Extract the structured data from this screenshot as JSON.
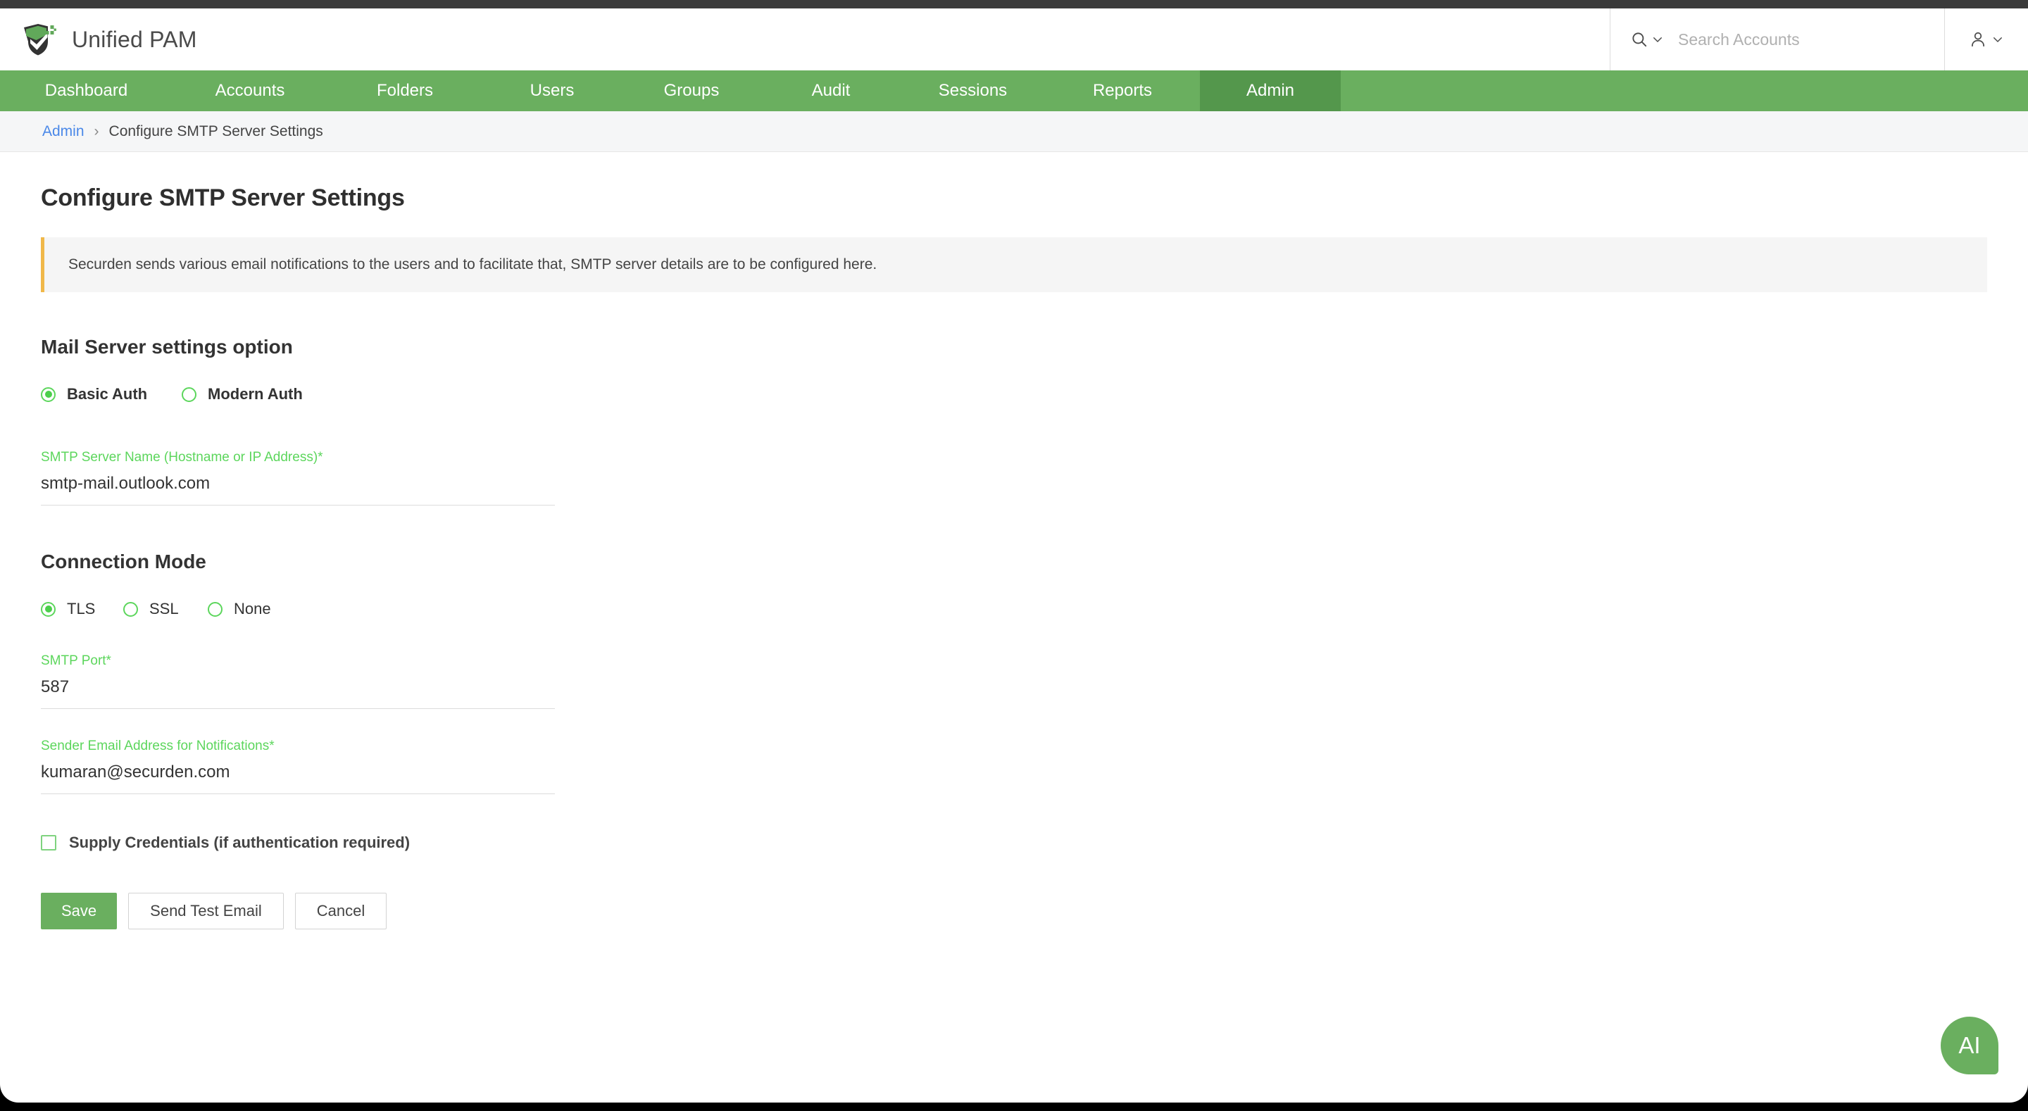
{
  "app": {
    "title": "Unified PAM",
    "logo_icon": "shield-check-logo"
  },
  "search": {
    "icon": "search-icon",
    "chevron_icon": "chevron-down-icon",
    "placeholder": "Search Accounts",
    "value": ""
  },
  "user_menu": {
    "icon": "user-icon",
    "chevron_icon": "chevron-down-icon"
  },
  "nav": {
    "items": [
      {
        "label": "Dashboard",
        "active": false
      },
      {
        "label": "Accounts",
        "active": false
      },
      {
        "label": "Folders",
        "active": false
      },
      {
        "label": "Users",
        "active": false
      },
      {
        "label": "Groups",
        "active": false
      },
      {
        "label": "Audit",
        "active": false
      },
      {
        "label": "Sessions",
        "active": false
      },
      {
        "label": "Reports",
        "active": false
      },
      {
        "label": "Admin",
        "active": true
      }
    ]
  },
  "breadcrumb": {
    "parent": "Admin",
    "separator": "›",
    "current": "Configure SMTP Server Settings"
  },
  "page": {
    "title": "Configure SMTP Server Settings",
    "info_banner": "Securden sends various email notifications to the users and to facilitate that, SMTP server details are to be configured here."
  },
  "mail_server_section": {
    "title": "Mail Server settings option",
    "options": [
      {
        "label": "Basic Auth",
        "selected": true
      },
      {
        "label": "Modern Auth",
        "selected": false
      }
    ]
  },
  "smtp_server": {
    "label": "SMTP Server Name (Hostname or IP Address)*",
    "value": "smtp-mail.outlook.com",
    "placeholder": ""
  },
  "connection_mode_section": {
    "title": "Connection Mode",
    "options": [
      {
        "label": "TLS",
        "selected": true
      },
      {
        "label": "SSL",
        "selected": false
      },
      {
        "label": "None",
        "selected": false
      }
    ]
  },
  "smtp_port": {
    "label": "SMTP Port*",
    "value": "587",
    "placeholder": ""
  },
  "sender_email": {
    "label": "Sender Email Address for Notifications*",
    "value": "kumaran@securden.com",
    "placeholder": ""
  },
  "supply_credentials": {
    "label": "Supply Credentials (if authentication required)",
    "checked": false
  },
  "buttons": {
    "save": "Save",
    "send_test_email": "Send Test Email",
    "cancel": "Cancel"
  },
  "ai_fab": {
    "label": "AI"
  },
  "colors": {
    "nav_green": "#6aaf5f",
    "nav_active_green": "#54974c",
    "accent_green": "#5cd65c",
    "link_blue": "#4a88e8",
    "banner_accent": "#f0b849"
  }
}
